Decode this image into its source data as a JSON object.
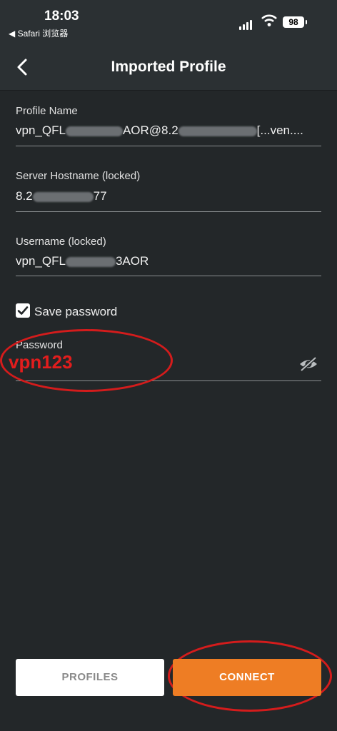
{
  "status": {
    "time": "18:03",
    "back_app": "◀ Safari 浏览器",
    "battery": "98"
  },
  "header": {
    "title": "Imported Profile"
  },
  "form": {
    "profile_name": {
      "label": "Profile Name",
      "value_start": "vpn_QFL",
      "value_mid": "AOR@8.2",
      "value_end": "[...ven...."
    },
    "hostname": {
      "label": "Server Hostname (locked)",
      "value_start": "8.2",
      "value_end": "77"
    },
    "username": {
      "label": "Username (locked)",
      "value_start": "vpn_QFL",
      "value_end": "3AOR"
    },
    "save_password": {
      "label": "Save password",
      "checked": true
    },
    "password": {
      "label": "Password",
      "value": "vpn123"
    }
  },
  "buttons": {
    "profiles": "PROFILES",
    "connect": "CONNECT"
  },
  "colors": {
    "background": "#232729",
    "header": "#2b3033",
    "accent": "#ee7d24",
    "annotation": "#d41c1c"
  }
}
